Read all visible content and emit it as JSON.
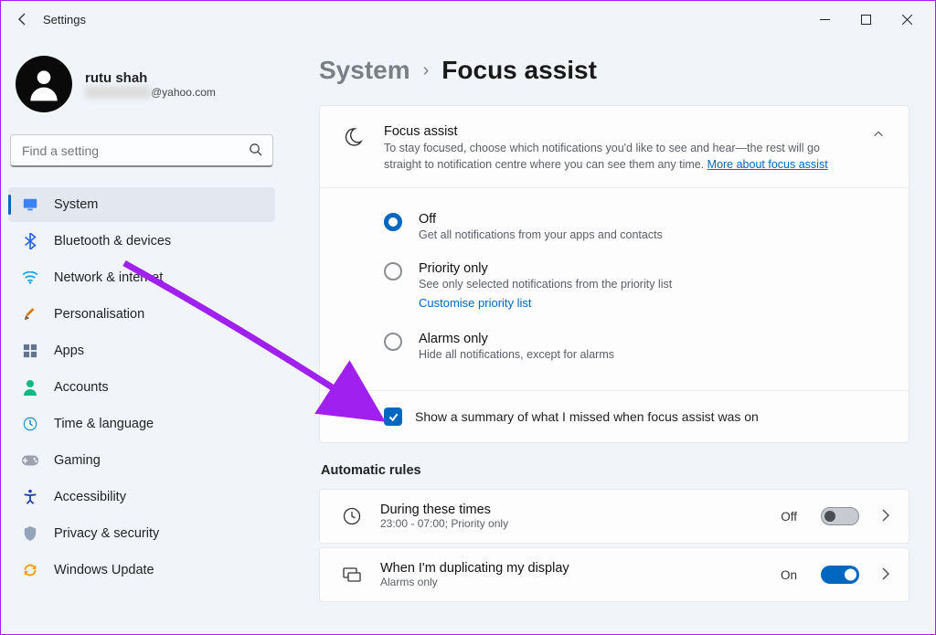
{
  "window": {
    "title": "Settings"
  },
  "user": {
    "name": "rutu shah",
    "email_suffix": "@yahoo.com"
  },
  "search": {
    "placeholder": "Find a setting"
  },
  "nav": [
    {
      "key": "system",
      "label": "System",
      "active": true
    },
    {
      "key": "bluetooth",
      "label": "Bluetooth & devices"
    },
    {
      "key": "network",
      "label": "Network & internet"
    },
    {
      "key": "personalisation",
      "label": "Personalisation"
    },
    {
      "key": "apps",
      "label": "Apps"
    },
    {
      "key": "accounts",
      "label": "Accounts"
    },
    {
      "key": "time",
      "label": "Time & language"
    },
    {
      "key": "gaming",
      "label": "Gaming"
    },
    {
      "key": "accessibility",
      "label": "Accessibility"
    },
    {
      "key": "privacy",
      "label": "Privacy & security"
    },
    {
      "key": "update",
      "label": "Windows Update"
    }
  ],
  "breadcrumb": {
    "parent": "System",
    "current": "Focus assist"
  },
  "focus_card": {
    "title": "Focus assist",
    "desc": "To stay focused, choose which notifications you'd like to see and hear—the rest will go straight to notification centre where you can see them any time.  ",
    "link": "More about focus assist",
    "options": [
      {
        "label": "Off",
        "desc": "Get all notifications from your apps and contacts",
        "checked": true
      },
      {
        "label": "Priority only",
        "desc": "See only selected notifications from the priority list",
        "link": "Customise priority list"
      },
      {
        "label": "Alarms only",
        "desc": "Hide all notifications, except for alarms"
      }
    ],
    "summary_checkbox": {
      "label": "Show a summary of what I missed when focus assist was on",
      "checked": true
    }
  },
  "rules_heading": "Automatic rules",
  "rules": [
    {
      "title": "During these times",
      "sub": "23:00 - 07:00; Priority only",
      "state": "Off",
      "on": false
    },
    {
      "title": "When I'm duplicating my display",
      "sub": "Alarms only",
      "state": "On",
      "on": true
    }
  ]
}
